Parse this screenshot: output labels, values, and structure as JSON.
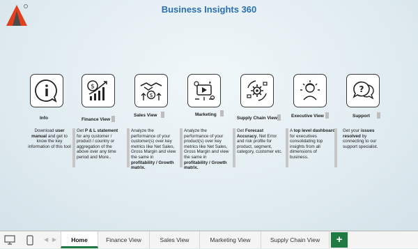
{
  "title": "Business Insights 360",
  "cards": [
    {
      "label": "Info",
      "desc_parts": [
        [
          "Download ",
          false
        ],
        [
          "user manual",
          true
        ],
        [
          " and get to know the key information of this tool",
          false
        ]
      ]
    },
    {
      "label": "Finance View",
      "desc_parts": [
        [
          "Get  ",
          false
        ],
        [
          "P & L statement",
          true
        ],
        [
          " for any customer / product / country or aggregation of the above over any time period and More..",
          false
        ]
      ]
    },
    {
      "label": "Sales View",
      "desc_parts": [
        [
          "Analyze the performance of your customer(s) over key metrics like Net Sales, Gross Margin and view the same in ",
          false
        ],
        [
          "profitability / Growth matrix.",
          true
        ]
      ]
    },
    {
      "label": "Marketing",
      "desc_parts": [
        [
          "Analyze the performance of your product(s) over key metrics like Net Sales, Gross Margin and view the same in ",
          false
        ],
        [
          "profitability / Growth matrix.",
          true
        ]
      ]
    },
    {
      "label": "Supply Chain View",
      "desc_parts": [
        [
          "Get ",
          false
        ],
        [
          "Forecast Accuracy",
          true
        ],
        [
          ", Net Error and risk profile for product, segment, category, customer etc.",
          false
        ]
      ]
    },
    {
      "label": "Executive View",
      "desc_parts": [
        [
          "A ",
          false
        ],
        [
          "top level dashboard",
          true
        ],
        [
          " for executives consolidating top insights from all dimensions of business.",
          false
        ]
      ]
    },
    {
      "label": "Support",
      "desc_parts": [
        [
          "Get your ",
          false
        ],
        [
          "issues resolved",
          true
        ],
        [
          " by connecting to our support specialist.",
          false
        ]
      ]
    }
  ],
  "tabs": [
    "Home",
    "Finance View",
    "Sales View",
    "Marketing View",
    "Supply Chain View"
  ],
  "active_tab": "Home",
  "add_label": "+",
  "colors": {
    "accent": "#2a6fb0",
    "tab_green": "#1f7a43",
    "logo_red": "#e0401c"
  }
}
